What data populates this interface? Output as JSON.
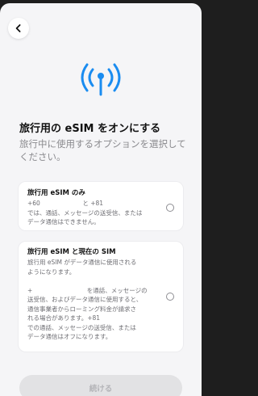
{
  "header": {
    "back_icon": "chevron-left-icon",
    "hero_icon": "antenna-broadcast-icon",
    "accent_color": "#1a8cf0"
  },
  "title": "旅行用の eSIM をオンにする",
  "subtitle": "旅行中に使用するオプションを選択してください。",
  "options": [
    {
      "title": "旅行用 eSIM のみ",
      "text_lines": [
        "+60　　　　　　　と +81",
        "では、通話、メッセージの送受信、または",
        "データ通信はできません。"
      ],
      "selected": false
    },
    {
      "title": "旅行用 eSIM と現在の SIM",
      "text_lines": [
        "旅行用 eSIM がデータ通信に使用される",
        "ようになります。",
        "",
        "+　　　　　　　　　を通話、メッセージの",
        "送受信、およびデータ通信に使用すると、",
        "通信事業者からローミング料金が請求さ",
        "れる場合があります。+81",
        "での通話、メッセージの送受信、または",
        "データ通信はオフになります。"
      ],
      "selected": false
    }
  ],
  "continue_label": "続ける"
}
